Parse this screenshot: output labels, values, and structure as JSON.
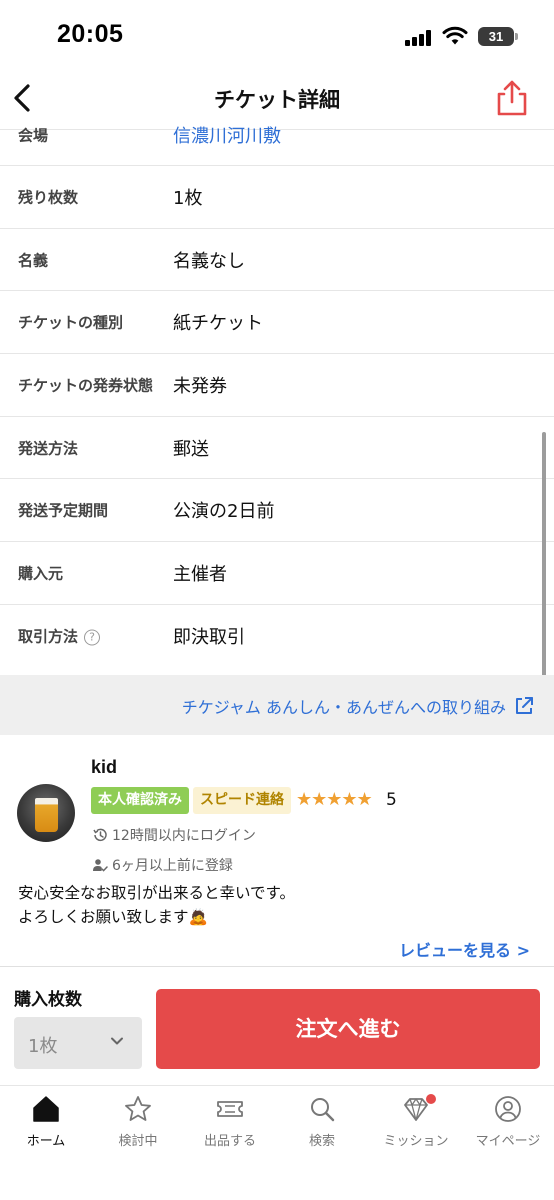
{
  "status_bar": {
    "time": "20:05",
    "battery": "31"
  },
  "nav": {
    "title": "チケット詳細"
  },
  "details": [
    {
      "label": "会場",
      "value": "信濃川河川敷",
      "is_link": true
    },
    {
      "label": "残り枚数",
      "value": "1枚"
    },
    {
      "label": "名義",
      "value": "名義なし"
    },
    {
      "label": "チケットの種別",
      "value": "紙チケット"
    },
    {
      "label": "チケットの発券状態",
      "value": "未発券"
    },
    {
      "label": "発送方法",
      "value": "郵送"
    },
    {
      "label": "発送予定期間",
      "value": "公演の2日前"
    },
    {
      "label": "購入元",
      "value": "主催者"
    },
    {
      "label": "取引方法",
      "value": "即決取引",
      "help": "?"
    }
  ],
  "safety_link": "チケジャム あんしん・あんぜんへの取り組み",
  "seller": {
    "name": "kid",
    "badge_identity": "本人確認済み",
    "badge_speed": "スピード連絡",
    "stars": "★★★★★",
    "rating": "5",
    "last_login": "12時間以内にログイン",
    "registered": "6ヶ月以上前に登録",
    "comment_line1": "安心安全なお取引が出来ると幸いです。",
    "comment_line2": "よろしくお願い致します🙇",
    "review_link": "レビューを見る >"
  },
  "purchase": {
    "qty_label": "購入枚数",
    "qty_value": "1枚",
    "order_button": "注文へ進む"
  },
  "tabs": [
    {
      "label": "ホーム",
      "icon": "home-icon"
    },
    {
      "label": "検討中",
      "icon": "star-icon"
    },
    {
      "label": "出品する",
      "icon": "ticket-icon"
    },
    {
      "label": "検索",
      "icon": "search-icon"
    },
    {
      "label": "ミッション",
      "icon": "diamond-icon"
    },
    {
      "label": "マイページ",
      "icon": "user-icon"
    }
  ],
  "colors": {
    "accent": "#e54a4a",
    "link": "#2f6fd6",
    "badge_green": "#8fcd55",
    "star": "#f0a032"
  }
}
